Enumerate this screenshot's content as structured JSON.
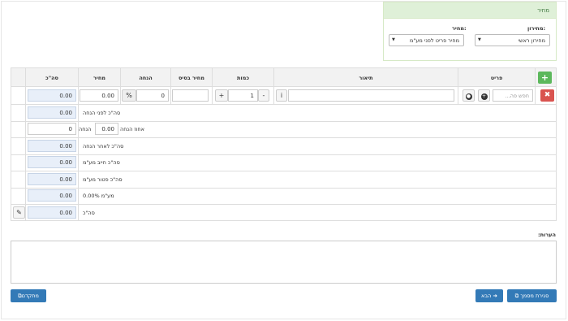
{
  "price_panel": {
    "header": "מחיר",
    "pricelist_label": "מחירון:",
    "pricelist_value": "מחירון ראשי",
    "price_label": "מחיר:",
    "price_value": "מחיר פריט לפני מע\"מ"
  },
  "table": {
    "columns": [
      "פריט",
      "תיאור",
      "כמות",
      "מחיר בסיס",
      "הנחה",
      "מחיר",
      "סה\"כ"
    ],
    "row": {
      "search_placeholder": "חפש פה...",
      "quantity": "1",
      "minus": "-",
      "plus": "+",
      "discount_value": "0",
      "percent": "%",
      "price": "0.00",
      "total": "0.00",
      "info": "i"
    },
    "summary": {
      "before_discount_label": "סה\"כ לפני הנחה",
      "before_discount_value": "0.00",
      "discount_label": "הנחה",
      "discount_percent_label": "אחוז הנחה",
      "discount_percent_value": "0.00",
      "discount_value": "0",
      "after_discount_label": "סה\"כ לאחר הנחה",
      "after_discount_value": "0.00",
      "vat_liable_label": "סה\"כ חייב מע\"מ",
      "vat_liable_value": "0.00",
      "vat_exempt_label": "סה\"כ פטור מע\"מ",
      "vat_exempt_value": "0.00",
      "vat_label": "מע\"מ 0.00%",
      "vat_value": "0.00",
      "total_label": "סה\"כ",
      "total_value": "0.00"
    }
  },
  "notes": {
    "label": "הערות:"
  },
  "footer": {
    "advanced_label": "מתקדם",
    "next_label": "הבא",
    "close_doc_label": "סגירת מסמך"
  },
  "colors": {
    "green": "#5cb85c",
    "red": "#d9534f",
    "blue": "#337ab7",
    "panel_header": "#dff0d8"
  }
}
